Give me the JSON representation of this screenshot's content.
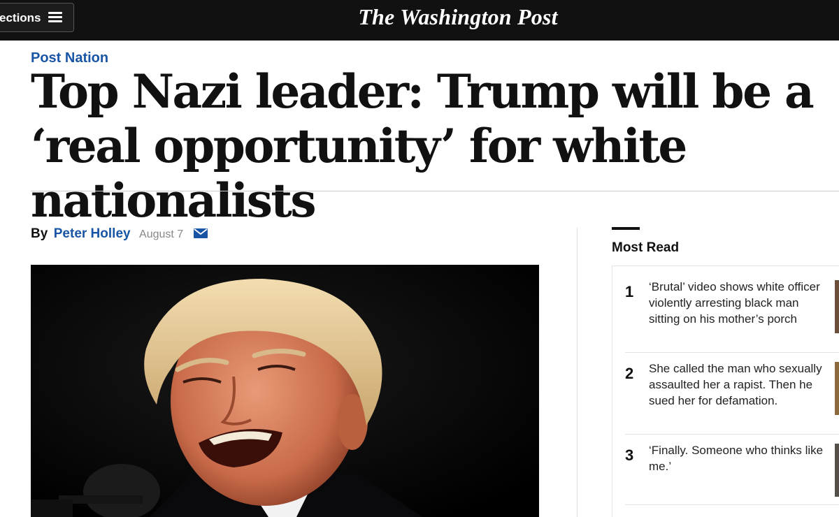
{
  "header": {
    "sections_label": "ections",
    "masthead": "The Washington Post"
  },
  "article": {
    "kicker": "Post Nation",
    "headline": "Top Nazi leader: Trump will be a ‘real opportunity’ for white nationalists",
    "byline_prefix": "By",
    "author": "Peter Holley",
    "date": "August 7"
  },
  "most_read": {
    "title": "Most Read",
    "items": [
      {
        "rank": "1",
        "headline": "‘Brutal’ video shows white officer violently arresting black man sitting on his mother’s porch"
      },
      {
        "rank": "2",
        "headline": "She called the man who sexually assaulted her a rapist. Then he sued her for defamation."
      },
      {
        "rank": "3",
        "headline": "‘Finally. Someone who thinks like me.’"
      }
    ]
  },
  "colors": {
    "accent_blue": "#1955a5",
    "topbar": "#111111"
  }
}
